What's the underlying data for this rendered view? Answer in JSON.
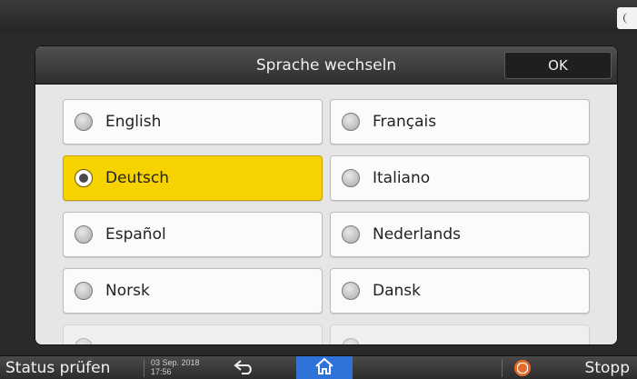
{
  "header": {
    "theme_icon": "moon-icon"
  },
  "dialog": {
    "title": "Sprache wechseln",
    "ok_label": "OK",
    "selected": "Deutsch",
    "options": [
      {
        "label": "English"
      },
      {
        "label": "Français"
      },
      {
        "label": "Deutsch"
      },
      {
        "label": "Italiano"
      },
      {
        "label": "Español"
      },
      {
        "label": "Nederlands"
      },
      {
        "label": "Norsk"
      },
      {
        "label": "Dansk"
      }
    ]
  },
  "footer": {
    "status_label": "Status prüfen",
    "date": "03 Sep. 2018",
    "time": "17:56",
    "stop_label": "Stopp"
  },
  "colors": {
    "selected_bg": "#f6d200",
    "home_button": "#2f72d8",
    "stop_icon": "#e46a2a"
  }
}
